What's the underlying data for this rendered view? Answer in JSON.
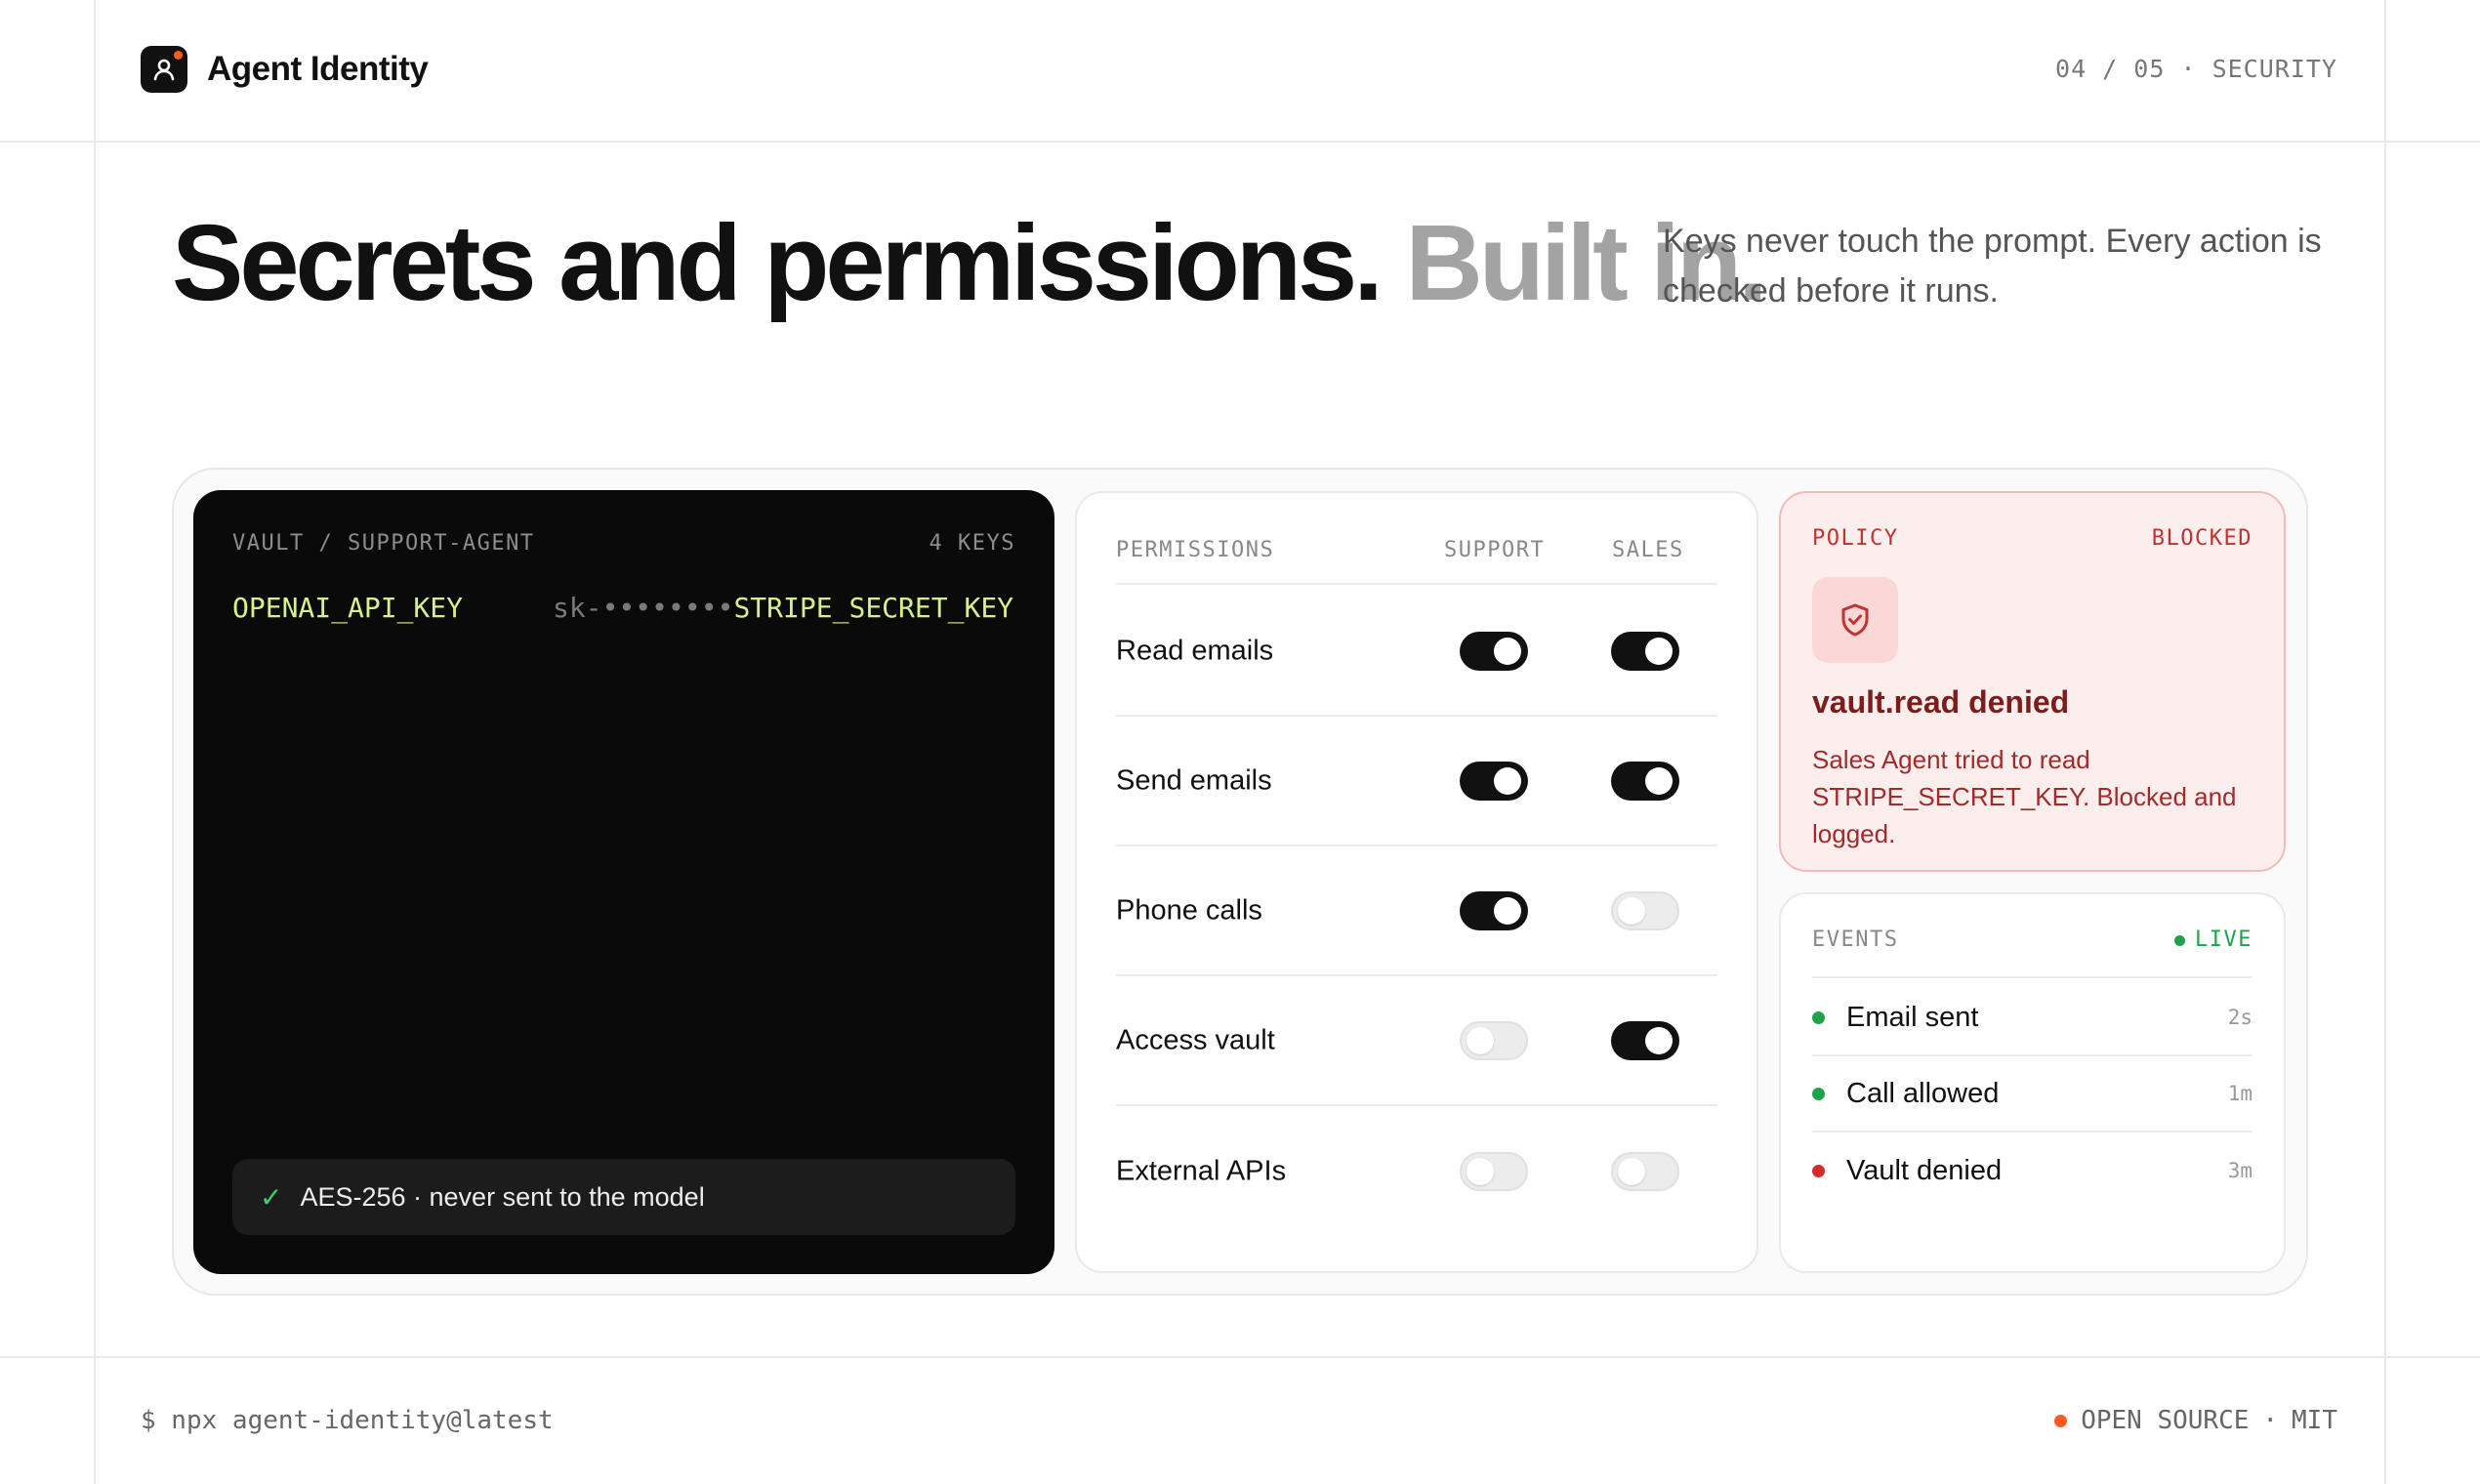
{
  "brand": {
    "name": "Agent Identity",
    "accent": "#ff5a1f"
  },
  "slide": {
    "position": "04 / 05",
    "separator": "·",
    "section": "SECURITY"
  },
  "hero": {
    "title": "Secrets and permissions.",
    "title_muted": "Built in.",
    "subtitle": "Keys never touch the prompt. Every action is checked before it runs."
  },
  "vault": {
    "path": "VAULT / SUPPORT-AGENT",
    "count": "4 KEYS",
    "keys": [
      {
        "name": "OPENAI_API_KEY",
        "value": "sk-••••••••"
      },
      {
        "name": "STRIPE_SECRET_KEY"
      }
    ],
    "footer": "AES-256 · never sent to the model",
    "footer_icon": "check-icon"
  },
  "permissions": {
    "header": "PERMISSIONS",
    "columns": [
      "SUPPORT",
      "SALES"
    ],
    "rows": [
      {
        "label": "Read emails",
        "support": true,
        "sales": true
      },
      {
        "label": "Send emails",
        "support": true,
        "sales": true
      },
      {
        "label": "Phone calls",
        "support": true,
        "sales": false
      },
      {
        "label": "Access vault",
        "support": false,
        "sales": true
      },
      {
        "label": "External APIs",
        "support": false,
        "sales": false
      }
    ]
  },
  "policy": {
    "header": "POLICY",
    "status": "BLOCKED",
    "icon": "shield-check-icon",
    "title": "vault.read denied",
    "description": "Sales Agent tried to read STRIPE_SECRET_KEY. Blocked and logged.",
    "color": "#c0332e"
  },
  "events": {
    "header": "EVENTS",
    "live_label": "LIVE",
    "items": [
      {
        "label": "Email sent",
        "time": "2s",
        "status_color": "#1fa34a"
      },
      {
        "label": "Call allowed",
        "time": "1m",
        "status_color": "#1fa34a"
      },
      {
        "label": "Vault denied",
        "time": "3m",
        "status_color": "#d62b2b"
      }
    ]
  },
  "footer": {
    "command": "$ npx agent-identity@latest",
    "license_label": "OPEN SOURCE",
    "license_sep": "·",
    "license": "MIT"
  }
}
